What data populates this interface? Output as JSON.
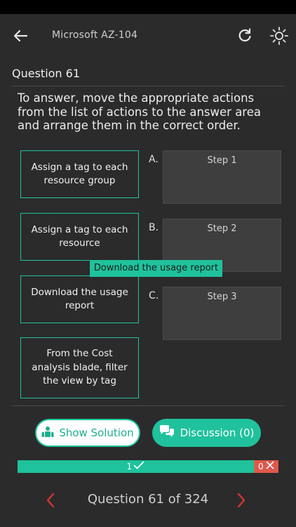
{
  "header": {
    "title": "Microsoft AZ-104",
    "icons": {
      "back": "arrow-left-icon",
      "reload": "reload-icon",
      "theme": "sun-icon"
    }
  },
  "question": {
    "heading": "Question 61",
    "text": "To answer, move the appropriate actions from the list of actions to the answer area and arrange them in the correct order."
  },
  "actions": [
    {
      "label": "Assign a tag to each resource group"
    },
    {
      "label": "Assign a tag to each resource"
    },
    {
      "label": "Download the usage report"
    },
    {
      "label": "From the Cost analysis blade, filter the view by tag"
    }
  ],
  "answer_area": [
    {
      "letter": "A.",
      "label": "Step 1"
    },
    {
      "letter": "B.",
      "label": "Step 2"
    },
    {
      "letter": "C.",
      "label": "Step 3"
    }
  ],
  "drag_tooltip": "Download the usage report",
  "buttons": {
    "show_solution": "Show Solution",
    "discussion": "Discussion (0)"
  },
  "progress": {
    "correct": "1",
    "wrong": "0",
    "correct_fraction": 0.905
  },
  "navigation": {
    "counter": "Question 61 of 324"
  },
  "colors": {
    "accent": "#1fc29c",
    "wrong": "#e0584c",
    "nav_arrow": "#d9342b",
    "background": "#2b2b2b"
  }
}
